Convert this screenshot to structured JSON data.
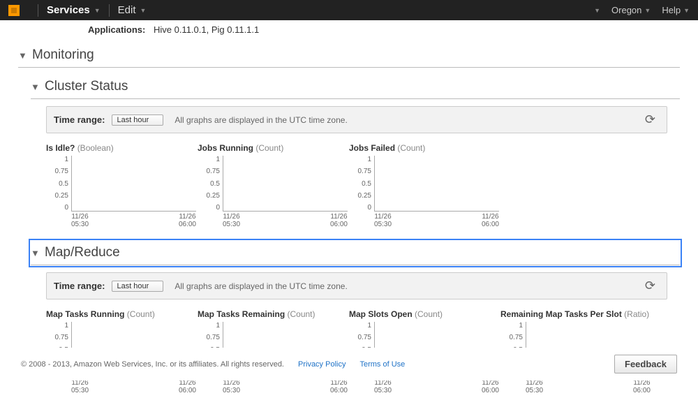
{
  "nav": {
    "services": "Services",
    "edit": "Edit",
    "region": "Oregon",
    "help": "Help"
  },
  "applications": {
    "label": "Applications:",
    "value": "Hive 0.11.0.1, Pig 0.11.1.1"
  },
  "sections": {
    "monitoring": "Monitoring",
    "cluster_status": "Cluster Status",
    "mapreduce": "Map/Reduce"
  },
  "timerange": {
    "label": "Time range:",
    "value": "Last hour",
    "utc_note": "All graphs are displayed in the UTC time zone."
  },
  "yticks": [
    "1",
    "0.75",
    "0.5",
    "0.25",
    "0"
  ],
  "xticks": [
    "11/26\n05:30",
    "11/26\n06:00"
  ],
  "cluster_charts": [
    {
      "metric": "Is Idle?",
      "unit": "(Boolean)"
    },
    {
      "metric": "Jobs Running",
      "unit": "(Count)"
    },
    {
      "metric": "Jobs Failed",
      "unit": "(Count)"
    }
  ],
  "mapreduce_charts": [
    {
      "metric": "Map Tasks Running",
      "unit": "(Count)"
    },
    {
      "metric": "Map Tasks Remaining",
      "unit": "(Count)"
    },
    {
      "metric": "Map Slots Open",
      "unit": "(Count)"
    },
    {
      "metric": "Remaining Map Tasks Per Slot",
      "unit": "(Ratio)"
    }
  ],
  "footer": {
    "copyright": "© 2008 - 2013, Amazon Web Services, Inc. or its affiliates. All rights reserved.",
    "privacy": "Privacy Policy",
    "terms": "Terms of Use",
    "feedback": "Feedback"
  },
  "chart_data": [
    {
      "type": "line",
      "title": "Is Idle? (Boolean)",
      "x": [
        "11/26 05:30",
        "11/26 06:00"
      ],
      "values": [],
      "ylim": [
        0,
        1
      ],
      "ylabel": "",
      "xlabel": ""
    },
    {
      "type": "line",
      "title": "Jobs Running (Count)",
      "x": [
        "11/26 05:30",
        "11/26 06:00"
      ],
      "values": [],
      "ylim": [
        0,
        1
      ],
      "ylabel": "",
      "xlabel": ""
    },
    {
      "type": "line",
      "title": "Jobs Failed (Count)",
      "x": [
        "11/26 05:30",
        "11/26 06:00"
      ],
      "values": [],
      "ylim": [
        0,
        1
      ],
      "ylabel": "",
      "xlabel": ""
    },
    {
      "type": "line",
      "title": "Map Tasks Running (Count)",
      "x": [
        "11/26 05:30",
        "11/26 06:00"
      ],
      "values": [],
      "ylim": [
        0,
        1
      ],
      "ylabel": "",
      "xlabel": ""
    },
    {
      "type": "line",
      "title": "Map Tasks Remaining (Count)",
      "x": [
        "11/26 05:30",
        "11/26 06:00"
      ],
      "values": [],
      "ylim": [
        0,
        1
      ],
      "ylabel": "",
      "xlabel": ""
    },
    {
      "type": "line",
      "title": "Map Slots Open (Count)",
      "x": [
        "11/26 05:30",
        "11/26 06:00"
      ],
      "values": [],
      "ylim": [
        0,
        1
      ],
      "ylabel": "",
      "xlabel": ""
    },
    {
      "type": "line",
      "title": "Remaining Map Tasks Per Slot (Ratio)",
      "x": [
        "11/26 05:30",
        "11/26 06:00"
      ],
      "values": [],
      "ylim": [
        0,
        1
      ],
      "ylabel": "",
      "xlabel": ""
    }
  ]
}
